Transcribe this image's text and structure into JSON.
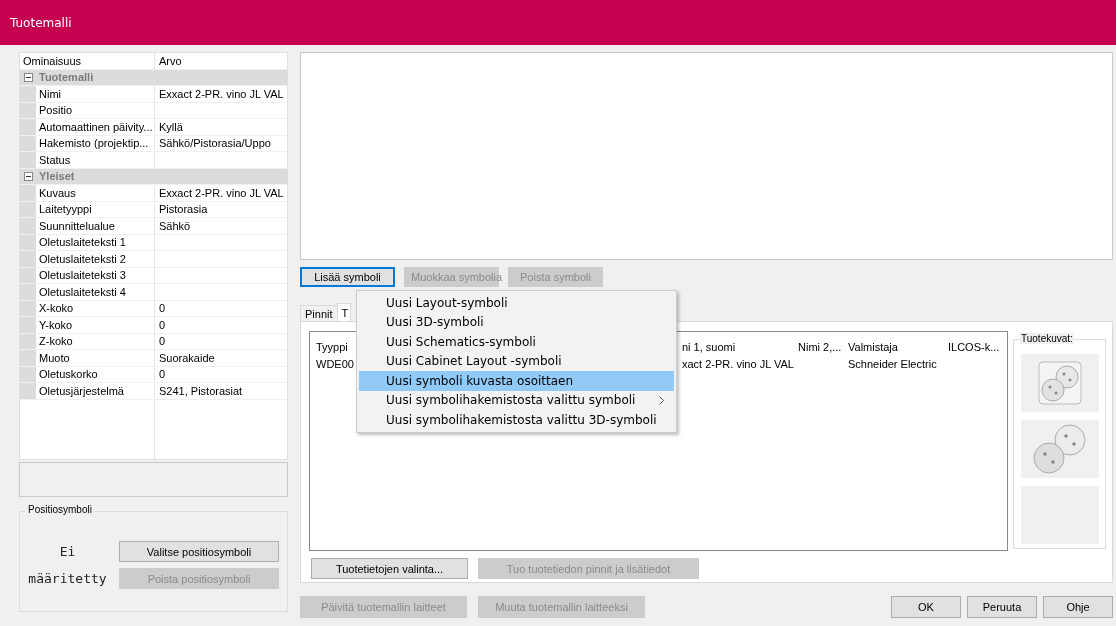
{
  "window": {
    "title": "Tuotemalli"
  },
  "properties": {
    "columns": [
      "Ominaisuus",
      "Arvo"
    ],
    "groups": [
      {
        "name": "Tuotemalli",
        "expanded": true,
        "children": [
          {
            "name": "Nimi",
            "value": "Exxact 2-PR. vino JL VAL"
          },
          {
            "name": "Positio"
          },
          {
            "name": "Automaattinen päivity...",
            "value": "Kyllä"
          },
          {
            "name": "Hakemisto (projektip...",
            "value": "Sähkö/Pistorasia/Uppo"
          },
          {
            "name": "Status"
          }
        ]
      },
      {
        "name": "Yleiset",
        "expanded": true,
        "children": [
          {
            "name": "Kuvaus",
            "value": "Exxact 2-PR. vino JL VAL"
          },
          {
            "name": "Laitetyyppi",
            "value": "Pistorasia"
          },
          {
            "name": "Suunnittelualue",
            "value": "Sähkö"
          },
          {
            "name": "Oletuslaiteteksti 1"
          },
          {
            "name": "Oletuslaiteteksti 2"
          },
          {
            "name": "Oletuslaiteteksti 3"
          },
          {
            "name": "Oletuslaiteteksti 4"
          },
          {
            "name": "X-koko",
            "value": "0"
          },
          {
            "name": "Y-koko",
            "value": "0"
          },
          {
            "name": "Z-koko",
            "value": "0"
          },
          {
            "name": "Muoto",
            "value": "Suorakaide"
          },
          {
            "name": "Oletuskorko",
            "value": "0"
          },
          {
            "name": "Oletusjärjestelmä",
            "value": "S241, Pistorasiat"
          }
        ]
      }
    ]
  },
  "position_symbol": {
    "title": "Positiosymboli",
    "status": "Ei määritetty",
    "buttons": [
      {
        "label": "Valitse positiosymboli",
        "disabled": false
      },
      {
        "label": "Poista positiosymboli",
        "disabled": true
      }
    ]
  },
  "symbol_buttons": [
    {
      "label": "Lisää symboli",
      "disabled": false,
      "focused": true
    },
    {
      "label": "Muokkaa symbolia",
      "disabled": true,
      "focused": false
    },
    {
      "label": "Poista symboli",
      "disabled": true,
      "focused": false
    }
  ],
  "tabs": [
    {
      "label": "Pinnit",
      "selected": false
    },
    {
      "label": "T",
      "selected": true
    }
  ],
  "table": {
    "columns": [
      "Tyyppi",
      "ni 1, suomi",
      "Nimi 2,...",
      "Valmistaja",
      "ILCOS-k..."
    ],
    "rows": [
      {
        "cells": [
          "WDE00",
          "xact 2-PR. vino JL VAL",
          null,
          "Schneider Electric",
          null
        ]
      }
    ]
  },
  "product_images": {
    "title": "Tuotekuvat:",
    "images": [
      {
        "kind": "socket_frame"
      },
      {
        "kind": "socket_pair"
      },
      {
        "kind": "empty"
      }
    ]
  },
  "panel_buttons": [
    {
      "label": "Tuotetietojen valinta...",
      "disabled": false
    },
    {
      "label": "Tuo tuotetiedon pinnit ja lisätiedot",
      "disabled": true
    }
  ],
  "bottom_buttons": [
    {
      "label": "Päivitä tuotemallin laitteet",
      "disabled": true
    },
    {
      "label": "Muuta tuotemallin laitteeksi",
      "disabled": true
    }
  ],
  "dialog_buttons": [
    {
      "label": "OK",
      "disabled": false
    },
    {
      "label": "Peruuta",
      "disabled": false
    },
    {
      "label": "Ohje",
      "disabled": false
    }
  ],
  "context_menu": {
    "items": [
      {
        "label": "Uusi Layout-symboli",
        "selected": false,
        "submenu": false
      },
      {
        "label": "Uusi 3D-symboli",
        "selected": false,
        "submenu": false
      },
      {
        "label": "Uusi Schematics-symboli",
        "selected": false,
        "submenu": false
      },
      {
        "label": "Uusi Cabinet Layout -symboli",
        "selected": false,
        "submenu": false
      },
      {
        "label": "Uusi symboli kuvasta osoittaen",
        "selected": true,
        "submenu": false
      },
      {
        "label": "Uusi symbolihakemistosta valittu symboli",
        "selected": false,
        "submenu": true
      },
      {
        "label": "Uusi symbolihakemistosta valittu 3D-symboli",
        "selected": false,
        "submenu": false
      }
    ]
  }
}
